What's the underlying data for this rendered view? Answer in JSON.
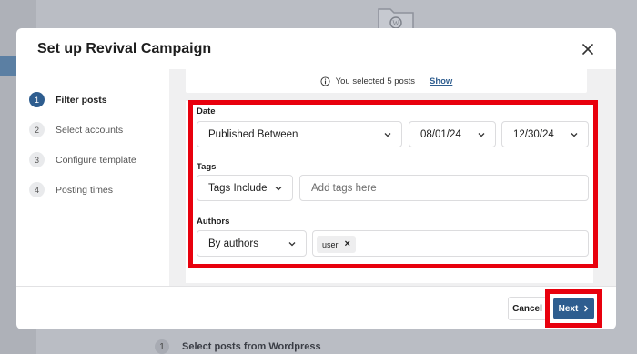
{
  "background": {
    "step_number": "1",
    "step_label": "Select posts from Wordpress"
  },
  "modal": {
    "title": "Set up Revival Campaign",
    "close_icon": "close-icon"
  },
  "steps": [
    {
      "number": "1",
      "label": "Filter posts",
      "active": true
    },
    {
      "number": "2",
      "label": "Select accounts",
      "active": false
    },
    {
      "number": "3",
      "label": "Configure template",
      "active": false
    },
    {
      "number": "4",
      "label": "Posting times",
      "active": false
    }
  ],
  "selection": {
    "text": "You selected 5 posts",
    "show_link": "Show"
  },
  "filters": {
    "date": {
      "label": "Date",
      "mode": "Published Between",
      "start": "08/01/24",
      "end": "12/30/24"
    },
    "tags": {
      "label": "Tags",
      "mode": "Tags Include",
      "placeholder": "Add tags here"
    },
    "authors": {
      "label": "Authors",
      "mode": "By authors",
      "selected": [
        "user"
      ]
    }
  },
  "footer": {
    "cancel_label": "Cancel",
    "next_label": "Next"
  },
  "colors": {
    "primary": "#2e5d8f",
    "highlight": "#e8000d"
  }
}
